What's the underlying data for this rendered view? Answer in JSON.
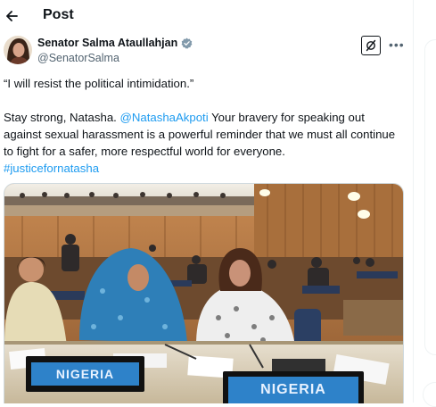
{
  "header": {
    "title": "Post"
  },
  "post": {
    "author_name": "Senator Salma Ataullahjan",
    "handle": "@SenatorSalma",
    "quote": "“I will resist the political intimidation.”",
    "body_prefix": "Stay strong, Natasha. ",
    "mention": "@NatashaAkpoti",
    "body_main": " Your bravery for speaking out against sexual harassment is a powerful reminder that we must all continue to fight for a safer, more respectful world for everyone.",
    "hashtag": "#justicefornatasha",
    "image": {
      "nameplate_left": "NIGERIA",
      "nameplate_right": "NIGERIA"
    }
  },
  "colors": {
    "link": "#1d9bf0",
    "verified": "#829aab",
    "secondary_text": "#536471"
  },
  "icons": [
    "back-arrow-icon",
    "verified-badge-icon",
    "grok-icon",
    "more-icon"
  ]
}
